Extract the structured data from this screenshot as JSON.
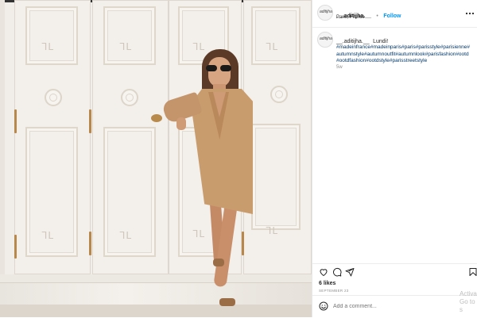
{
  "post": {
    "username": "__.aditijha.__",
    "separator": "•",
    "follow_label": "Follow",
    "location": "Paris, France",
    "avatar_text": "aditijha",
    "caption_user": "__.aditijha.__",
    "caption_text": "Lundi!",
    "hashtags": "#madeinfrance#madeinparis#paris#parisstyle#parisienne#autumnstyle#autumnoutfit#autumnlook#parisfashion#ootd#ootdfashion#ootdstyle#parisstreetstyle",
    "caption_age": "5w",
    "likes": "6 likes",
    "date": "SEPTEMBER 23",
    "comment_placeholder": "Add a comment..."
  },
  "icons": {
    "more": "more-icon",
    "like": "heart-icon",
    "comment": "comment-icon",
    "share": "share-icon",
    "save": "bookmark-icon",
    "emoji": "emoji-icon"
  },
  "overlay": {
    "activate_line1": "Activa",
    "activate_line2": "Go to s"
  },
  "colors": {
    "link": "#0095f6",
    "hashtag": "#00376b",
    "coat": "#c99c6d",
    "doors": "#f3efea"
  }
}
